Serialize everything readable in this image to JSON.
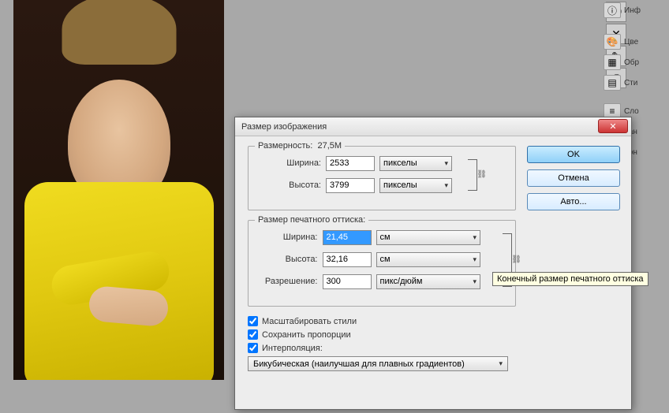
{
  "dialog": {
    "title": "Размер изображения",
    "pixel_dimensions": {
      "legend": "Размерность:",
      "size": "27,5M",
      "width_label": "Ширина:",
      "width_value": "2533",
      "width_unit": "пикселы",
      "height_label": "Высота:",
      "height_value": "3799",
      "height_unit": "пикселы"
    },
    "document_size": {
      "legend": "Размер печатного оттиска:",
      "width_label": "Ширина:",
      "width_value": "21,45",
      "width_unit": "см",
      "height_label": "Высота:",
      "height_value": "32,16",
      "height_unit": "см",
      "resolution_label": "Разрешение:",
      "resolution_value": "300",
      "resolution_unit": "пикс/дюйм"
    },
    "scale_styles": "Масштабировать стили",
    "constrain": "Сохранить пропорции",
    "resample": "Интерполяция:",
    "resample_method": "Бикубическая (наилучшая для плавных градиентов)",
    "buttons": {
      "ok": "OK",
      "cancel": "Отмена",
      "auto": "Авто..."
    },
    "close": "✕"
  },
  "tooltip": "Конечный размер печатного оттиска",
  "panels": {
    "info": "Инф",
    "color": "Цве",
    "samples": "Обр",
    "styles": "Сти",
    "layers": "Сло",
    "channels": "Кан",
    "paths": "Кон"
  }
}
